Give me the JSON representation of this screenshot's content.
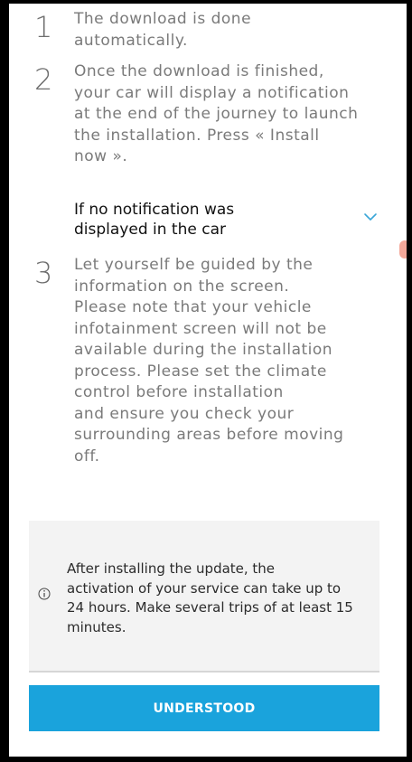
{
  "steps": [
    {
      "number": "1",
      "text": "The download is done\nautomatically."
    },
    {
      "number": "2",
      "text": "Once the download is finished,\nyour car will display a notification\nat the end of the journey to launch\nthe installation. Press « Install\nnow »."
    },
    {
      "number": "3",
      "text": "Let yourself be guided by the\ninformation on the screen.\nPlease note that your vehicle\ninfotainment screen will not be\navailable during the installation\nprocess. Please set the climate\ncontrol before installation\nand ensure you check your\nsurrounding areas before moving\noff."
    }
  ],
  "accordion": {
    "label": "If no notification was\ndisplayed in the car",
    "icon": "chevron-down-icon",
    "expanded": false
  },
  "info": {
    "icon": "info-icon",
    "text": "After installing the update, the\nactivation of your service can take up to\n24 hours. Make several trips of at least 15\nminutes."
  },
  "cta": {
    "label": "UNDERSTOOD"
  },
  "colors": {
    "accent": "#1aa3dc",
    "chevron": "#3aa6d8",
    "info_bg": "#f3f3f3",
    "scroll_indicator": "#f3a89a"
  }
}
